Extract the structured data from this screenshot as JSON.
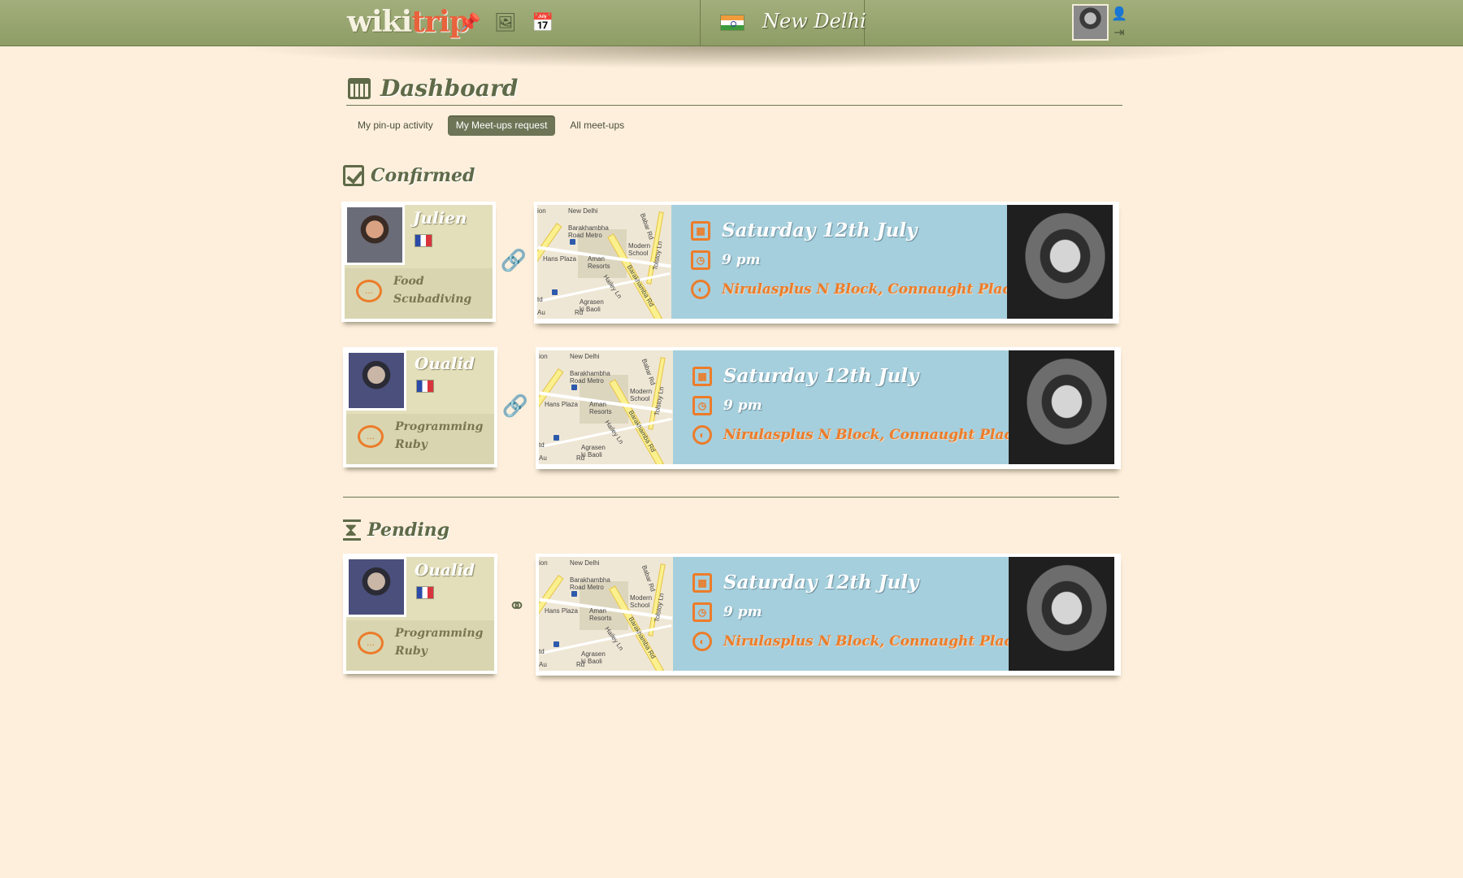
{
  "brand": {
    "logo_part1": "wiki",
    "logo_part2": "trip"
  },
  "topnav": {
    "icons": [
      "pin-icon",
      "photos-icon",
      "calendar-icon"
    ]
  },
  "city": {
    "name": "New Delhi",
    "flag": "india-flag-icon"
  },
  "page": {
    "title": "Dashboard",
    "tabs": [
      {
        "label": "My pin-up activity",
        "active": false
      },
      {
        "label": "My Meet-ups request",
        "active": true
      },
      {
        "label": "All meet-ups",
        "active": false
      }
    ]
  },
  "sections": {
    "confirmed": {
      "title": "Confirmed",
      "rows": [
        {
          "name": "Julien",
          "interests": [
            "Food",
            "Scubadiving"
          ],
          "date": "Saturday 12th July",
          "time": "9 pm",
          "place": "Nirulasplus N Block, Connaught Place"
        },
        {
          "name": "Oualid",
          "interests": [
            "Programming",
            "Ruby"
          ],
          "date": "Saturday 12th July",
          "time": "9 pm",
          "place": "Nirulasplus N Block, Connaught Place"
        }
      ]
    },
    "pending": {
      "title": "Pending",
      "rows": [
        {
          "name": "Oualid",
          "interests": [
            "Programming",
            "Ruby"
          ],
          "date": "Saturday 12th July",
          "time": "9 pm",
          "place": "Nirulasplus N Block, Connaught Place"
        }
      ]
    }
  },
  "map_labels": {
    "top": "New Delhi",
    "metro": "Barakhambha Road Metro",
    "hotel": "Hans Plaza",
    "resort": "Aman Resorts",
    "school": "Modern School",
    "road1": "Barakhamba Rd",
    "road2": "Babar Rd",
    "road3": "Tolstoy Ln",
    "lane": "Hailey Ln",
    "baoli": "Agrasen ki Baoli",
    "rd": "Rd",
    "edge1": "ion",
    "edge2": "td",
    "edge3": "Au"
  },
  "colors": {
    "accent": "#ec7c2a",
    "olive": "#5f6a48",
    "sky": "#a5cfdd",
    "background": "#fdefdc"
  }
}
